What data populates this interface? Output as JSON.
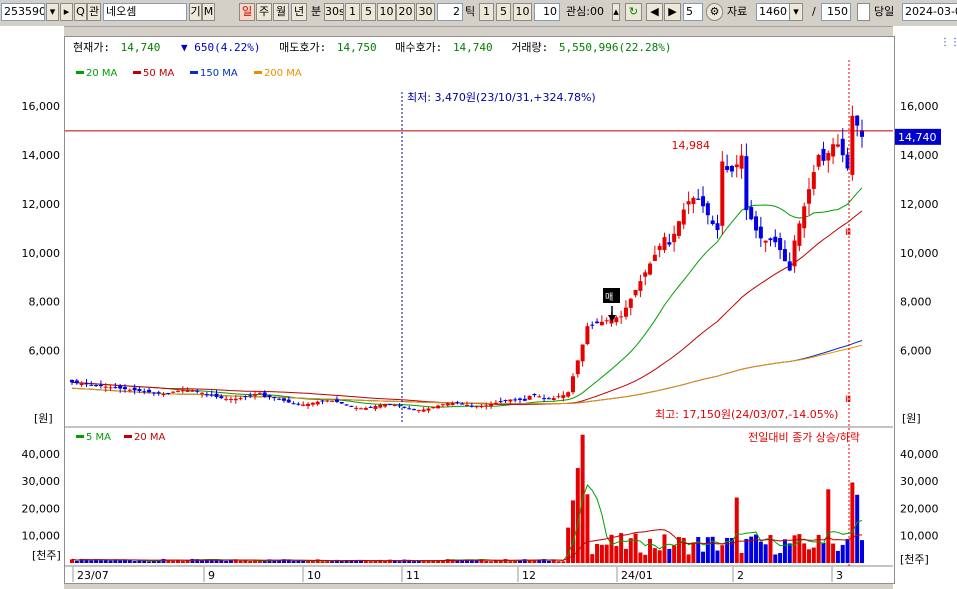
{
  "toolbar": {
    "code": "253590",
    "name": "네오셈",
    "period_buttons": [
      "일",
      "주",
      "월",
      "년",
      "분"
    ],
    "minute_buttons": [
      "30s",
      "1",
      "5",
      "10",
      "20",
      "30"
    ],
    "tick_value": "2",
    "tick_label": "틱",
    "tick_buttons": [
      "1",
      "5",
      "10"
    ],
    "tick_input": "10",
    "watch_label": "관심:00",
    "step_value": "5",
    "data_label": "자료",
    "data_count": "1460",
    "page_total": "150",
    "today_label": "당일",
    "date": "2024-03-0",
    "flag_a": "기",
    "flag_b": "M",
    "search_glyph": "Q",
    "kwan": "관"
  },
  "info": {
    "price_label": "현재가:",
    "price": "14,740",
    "change": "650(4.22%)",
    "ask_label": "매도호가:",
    "ask": "14,750",
    "bid_label": "매수호가:",
    "bid": "14,740",
    "volume_label": "거래량:",
    "volume": "5,550,996(22.28%)"
  },
  "colors": {
    "up": "#e60000",
    "down": "#0000e6",
    "ma20": "#00a000",
    "ma50": "#c00000",
    "ma150": "#0030c0",
    "ma200": "#e89000",
    "hline": "#c00000",
    "price_tag": "#0000cc"
  },
  "chart_data": [
    {
      "type": "candlestick",
      "unit_label": "[원]",
      "ylim": [
        3000,
        17800
      ],
      "y_ticks": [
        6000,
        8000,
        10000,
        12000,
        14000,
        16000
      ],
      "y_tick_labels": [
        "6,000",
        "8,000",
        "10,000",
        "12,000",
        "14,000",
        "16,000"
      ],
      "x_labels": [
        "23/07",
        "9",
        "10",
        "11",
        "12",
        "24/01",
        "2",
        "3"
      ],
      "legend": [
        {
          "name": "20 MA",
          "color": "#00a000"
        },
        {
          "name": "50 MA",
          "color": "#c00000"
        },
        {
          "name": "150 MA",
          "color": "#0030c0"
        },
        {
          "name": "200 MA",
          "color": "#e89000"
        }
      ],
      "annotations": {
        "low": "최저: 3,470원(23/10/31,+324.78%)",
        "high": "최고: 17,150원(24/03/07,-14.05%)",
        "level_label": "14,984",
        "level_value": 14984,
        "current_price": "14,740",
        "marker": "Ⅲ"
      },
      "candles_sample": [
        {
          "date": "23/07 start",
          "open": 4800,
          "high": 5200,
          "low": 4500,
          "close": 4700
        },
        {
          "date": "23/10/31",
          "open": 3700,
          "high": 3800,
          "low": 3470,
          "close": 3550
        },
        {
          "date": "24/02 mid",
          "open": 14200,
          "high": 15000,
          "low": 12800,
          "close": 13400
        },
        {
          "date": "24/03/07",
          "open": 15700,
          "high": 17150,
          "low": 14600,
          "close": 15000
        },
        {
          "date": "last",
          "open": 15500,
          "high": 15600,
          "low": 14500,
          "close": 14740
        }
      ]
    },
    {
      "type": "bar",
      "unit_label": "[천주]",
      "ylim": [
        0,
        48000
      ],
      "y_ticks": [
        10000,
        20000,
        30000,
        40000
      ],
      "y_tick_labels": [
        "10,000",
        "20,000",
        "30,000",
        "40,000"
      ],
      "legend": [
        {
          "name": "5 MA",
          "color": "#00a000"
        },
        {
          "name": "20 MA",
          "color": "#c00000"
        }
      ],
      "note": "전일대비 종가 상승/하락"
    }
  ]
}
